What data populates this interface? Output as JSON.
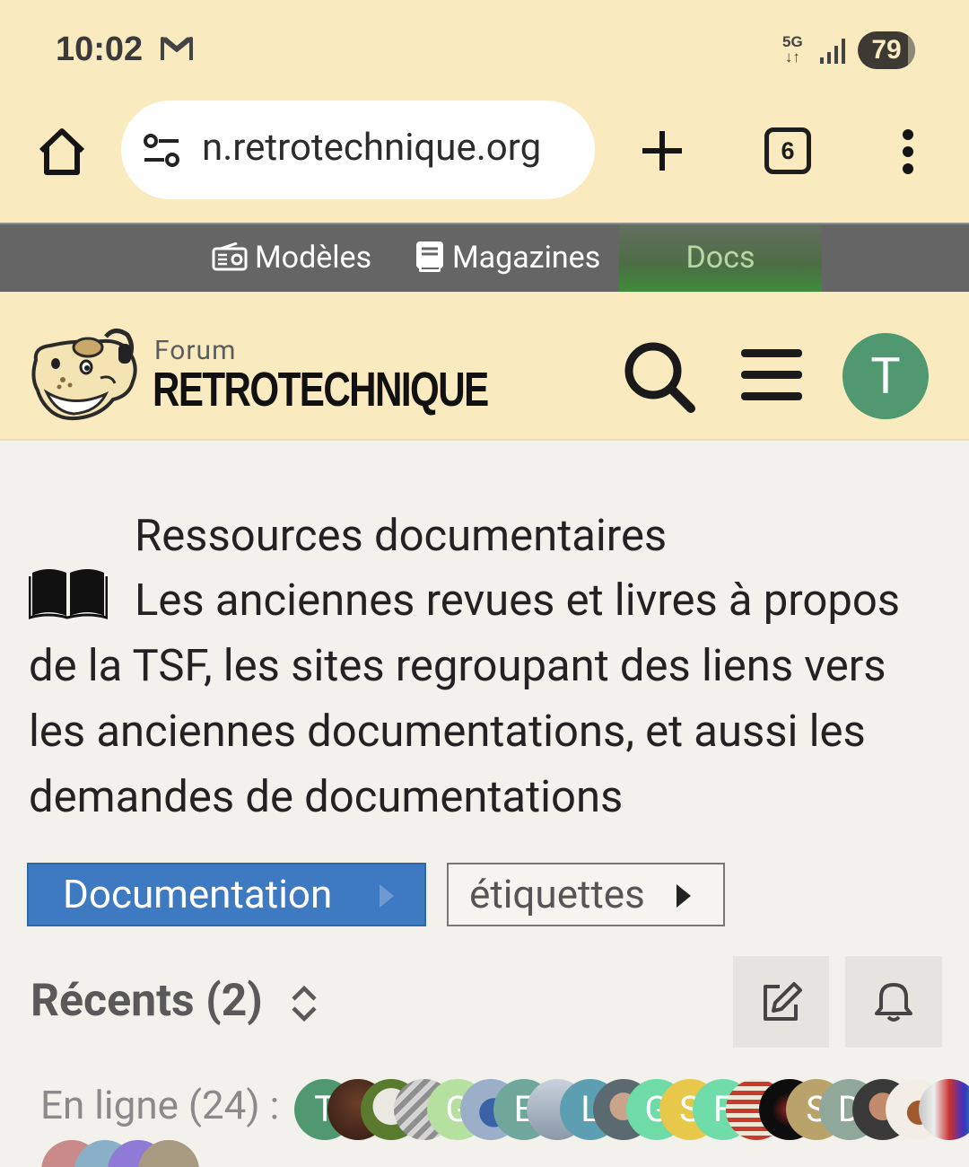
{
  "status_bar": {
    "time": "10:02",
    "network": "5G",
    "battery": "79"
  },
  "browser": {
    "url": "n.retrotechnique.org",
    "tab_count": "6"
  },
  "site_nav": {
    "models": "Modèles",
    "magazines": "Magazines",
    "docs": "Docs"
  },
  "header": {
    "forum_label": "Forum",
    "site_name": "RETROTECHNIQUE",
    "avatar_letter": "T"
  },
  "category": {
    "title": "Ressources documentaires",
    "description": "Les anciennes revues et livres à propos de la TSF, les sites regroupant des liens vers les anciennes documentations, et aussi les demandes de documentations"
  },
  "buttons": {
    "documentation": "Documentation",
    "tags": "étiquettes"
  },
  "recents": {
    "label": "Récents (2)"
  },
  "online": {
    "label": "En ligne (24) :",
    "avatars": [
      "T",
      "",
      "",
      "",
      "G",
      "",
      "E",
      "",
      "L",
      "",
      "G",
      "S",
      "F",
      "",
      "",
      "S",
      "D",
      "",
      "",
      ""
    ]
  },
  "colors": {
    "top_bg": "#f9ebbf",
    "nav_bg": "#656565",
    "primary": "#3e7ac2",
    "avatar": "#4f9870"
  }
}
